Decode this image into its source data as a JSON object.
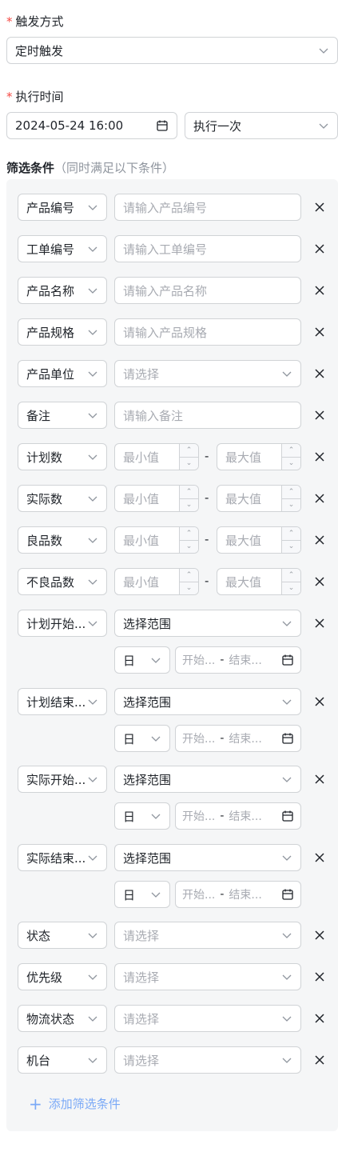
{
  "trigger": {
    "label": "触发方式",
    "value": "定时触发"
  },
  "exec": {
    "label": "执行时间",
    "datetime": "2024-05-24 16:00",
    "frequency": "执行一次"
  },
  "filters_title": {
    "main": "筛选条件",
    "hint": "（同时满足以下条件）"
  },
  "rows": [
    {
      "field": "产品编号",
      "placeholder": "请输入产品编号"
    },
    {
      "field": "工单编号",
      "placeholder": "请输入工单编号"
    },
    {
      "field": "产品名称",
      "placeholder": "请输入产品名称"
    },
    {
      "field": "产品规格",
      "placeholder": "请输入产品规格"
    },
    {
      "field": "产品单位",
      "placeholder": "请选择"
    },
    {
      "field": "备注",
      "placeholder": "请输入备注"
    },
    {
      "field": "计划数",
      "min": "最小值",
      "max": "最大值"
    },
    {
      "field": "实际数",
      "min": "最小值",
      "max": "最大值"
    },
    {
      "field": "良品数",
      "min": "最小值",
      "max": "最大值"
    },
    {
      "field": "不良品数",
      "min": "最小值",
      "max": "最大值"
    },
    {
      "field": "计划开始...",
      "range": "选择范围",
      "unit": "日",
      "start": "开始...",
      "end": "结束..."
    },
    {
      "field": "计划结束...",
      "range": "选择范围",
      "unit": "日",
      "start": "开始...",
      "end": "结束..."
    },
    {
      "field": "实际开始...",
      "range": "选择范围",
      "unit": "日",
      "start": "开始...",
      "end": "结束..."
    },
    {
      "field": "实际结束...",
      "range": "选择范围",
      "unit": "日",
      "start": "开始...",
      "end": "结束..."
    },
    {
      "field": "状态",
      "placeholder": "请选择"
    },
    {
      "field": "优先级",
      "placeholder": "请选择"
    },
    {
      "field": "物流状态",
      "placeholder": "请选择"
    },
    {
      "field": "机台",
      "placeholder": "请选择"
    }
  ],
  "dash": "-",
  "add_label": "添加筛选条件",
  "icons": {
    "chevron": "chevron-down-icon",
    "close": "close-icon",
    "calendar": "calendar-icon",
    "plus": "plus-icon"
  },
  "colors": {
    "required": "#f54a45",
    "link": "#7aa9f7",
    "panel": "#f5f6f7",
    "border": "#d0d3d6"
  }
}
